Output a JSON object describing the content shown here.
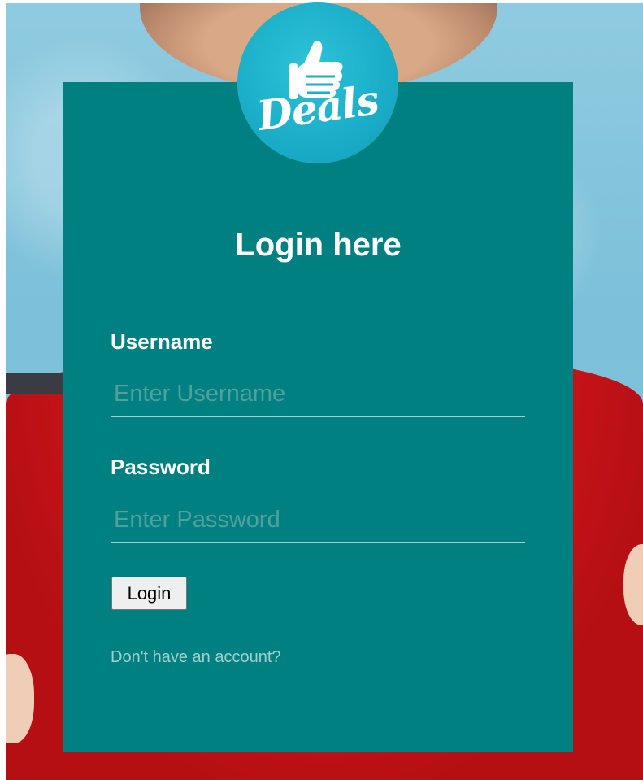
{
  "logo": {
    "text": "Deals",
    "color": "#1aaec8"
  },
  "panel": {
    "background": "#008080"
  },
  "form": {
    "title": "Login here",
    "username_label": "Username",
    "username_placeholder": "Enter Username",
    "username_value": "",
    "password_label": "Password",
    "password_placeholder": "Enter Password",
    "password_value": "",
    "login_button_label": "Login",
    "signup_link_text": "Don't have an account?"
  }
}
